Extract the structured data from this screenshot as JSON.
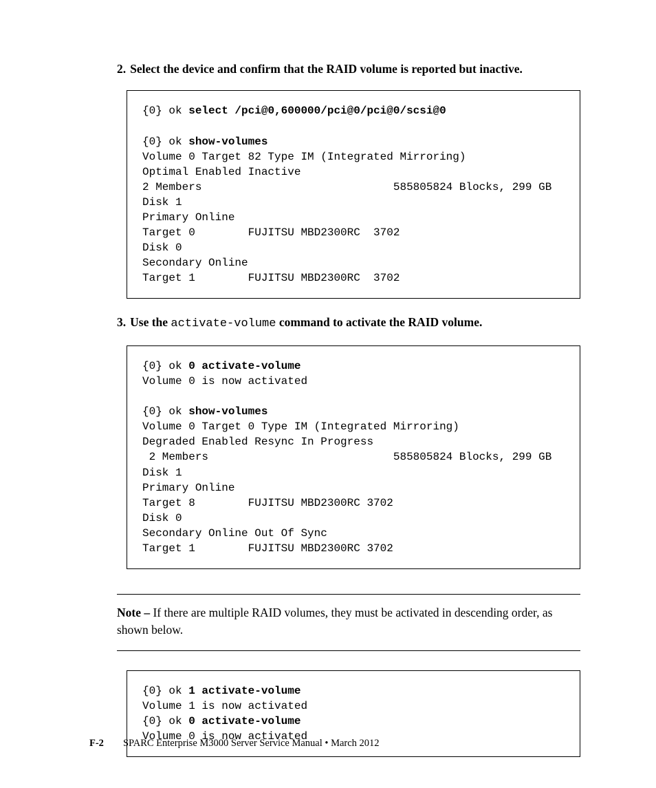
{
  "step2": {
    "num": "2.",
    "text": "Select the device and confirm that the RAID volume is reported but inactive."
  },
  "code1": {
    "l1_prompt": "{0} ok ",
    "l1_cmd": "select /pci@0,600000/pci@0/pci@0/scsi@0",
    "l2": "",
    "l3_prompt": "{0} ok ",
    "l3_cmd": "show-volumes",
    "l4": "Volume 0 Target 82 Type IM (Integrated Mirroring)",
    "l5": "Optimal Enabled Inactive",
    "l6": "2 Members                             585805824 Blocks, 299 GB",
    "l7": "Disk 1",
    "l8": "Primary Online",
    "l9": "Target 0        FUJITSU MBD2300RC  3702",
    "l10": "Disk 0",
    "l11": "Secondary Online",
    "l12": "Target 1        FUJITSU MBD2300RC  3702"
  },
  "step3": {
    "num": "3.",
    "pre": "Use the ",
    "cmd": "activate-volume",
    "post": " command to activate the RAID volume."
  },
  "code2": {
    "l1_prompt": "{0} ok ",
    "l1_cmd": "0 activate-volume",
    "l2": "Volume 0 is now activated",
    "l3": "",
    "l4_prompt": "{0} ok ",
    "l4_cmd": "show-volumes",
    "l5": "Volume 0 Target 0 Type IM (Integrated Mirroring)",
    "l6": "Degraded Enabled Resync In Progress",
    "l7": " 2 Members                            585805824 Blocks, 299 GB",
    "l8": "Disk 1",
    "l9": "Primary Online",
    "l10": "Target 8        FUJITSU MBD2300RC 3702",
    "l11": "Disk 0",
    "l12": "Secondary Online Out Of Sync",
    "l13": "Target 1        FUJITSU MBD2300RC 3702"
  },
  "note": {
    "lead": "Note – ",
    "text": "If there are multiple RAID volumes, they must be activated in descending order, as shown below."
  },
  "code3": {
    "l1_prompt": "{0} ok ",
    "l1_cmd": "1 activate-volume",
    "l2": "Volume 1 is now activated",
    "l3_prompt": "{0} ok ",
    "l3_cmd": "0 activate-volume",
    "l4": "Volume 0 is now activated"
  },
  "footer": {
    "pnum": "F-2",
    "title": "SPARC Enterprise M3000 Server Service Manual  •  March 2012"
  }
}
